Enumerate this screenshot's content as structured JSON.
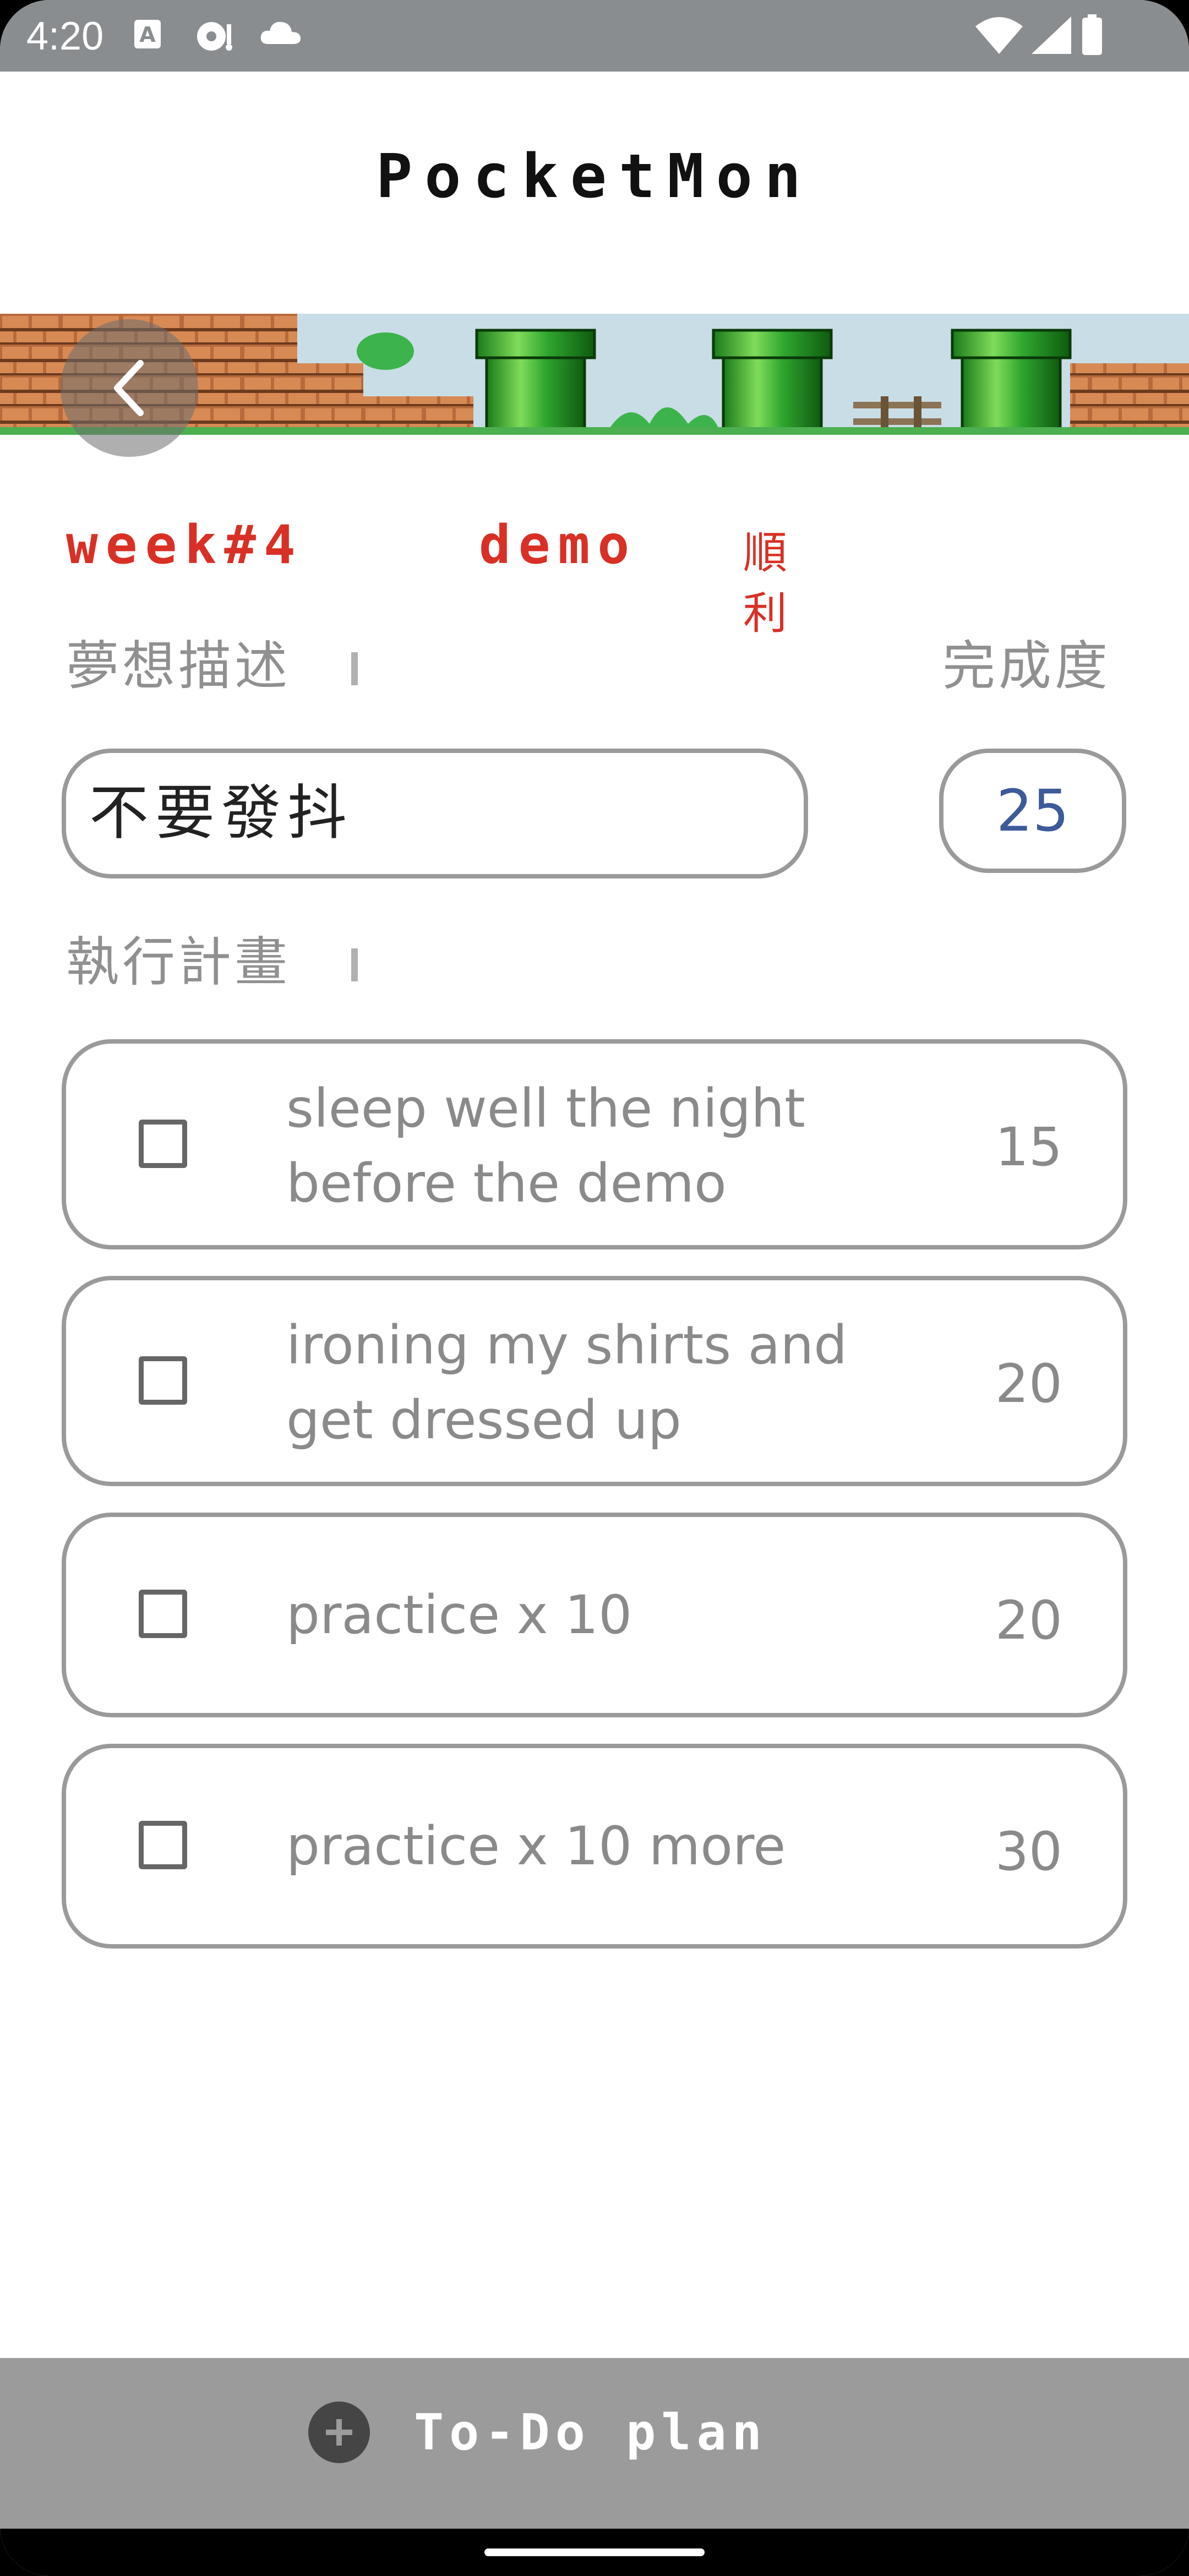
{
  "status_bar": {
    "time": "4:20"
  },
  "app": {
    "title": "PocketMon"
  },
  "week": {
    "label": "week#4",
    "title": "demo",
    "subtitle": "順利"
  },
  "dream": {
    "label": "夢想描述",
    "value": "不要發抖"
  },
  "progress": {
    "label": "完成度",
    "value": "25"
  },
  "plan": {
    "label": "執行計畫",
    "items": [
      {
        "text": "sleep well the night before the demo",
        "score": "15",
        "checked": false
      },
      {
        "text": "ironing my shirts and get dressed up",
        "score": "20",
        "checked": false
      },
      {
        "text": "practice x 10",
        "score": "20",
        "checked": false
      },
      {
        "text": "practice x 10 more",
        "score": "30",
        "checked": false
      }
    ]
  },
  "footer": {
    "add_label": "To-Do plan"
  },
  "colors": {
    "accent_red": "#d93025",
    "progress_blue": "#3d5a99",
    "bar_gray": "#9b9b9b"
  }
}
